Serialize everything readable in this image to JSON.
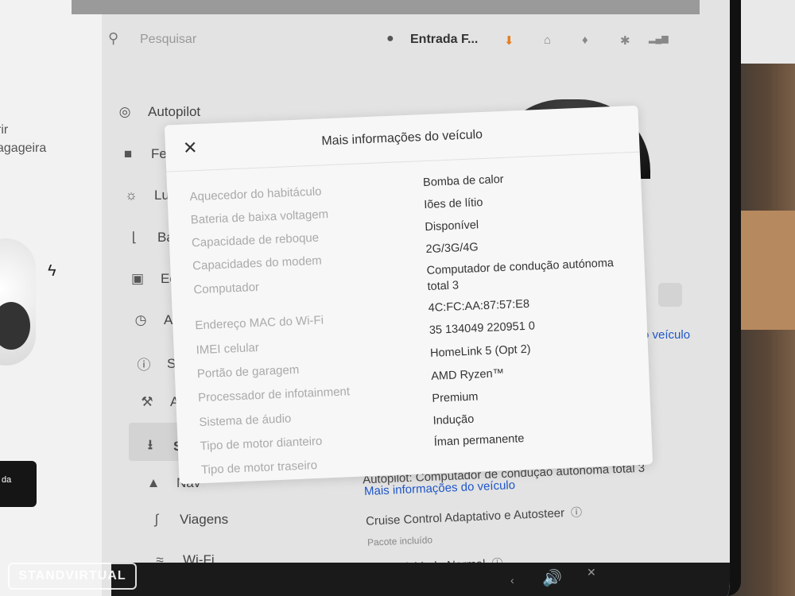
{
  "search": {
    "placeholder": "Pesquisar"
  },
  "header": {
    "profile_name": "Entrada F...",
    "icons": [
      "person-icon",
      "download-icon",
      "garage-icon",
      "bell-icon",
      "bluetooth-icon",
      "lte-signal-icon"
    ]
  },
  "left_panel": {
    "text_1": "rir",
    "text_2": "agageira",
    "button_label": "da"
  },
  "sidebar": {
    "items": [
      {
        "label": "Autopilot",
        "icon": "steering-wheel-icon"
      },
      {
        "label": "Fec",
        "icon": "lock-icon"
      },
      {
        "label": "Luz",
        "icon": "light-icon"
      },
      {
        "label": "Bar",
        "icon": "seat-icon"
      },
      {
        "label": "Ecr",
        "icon": "display-icon"
      },
      {
        "label": "Age",
        "icon": "alarm-icon"
      },
      {
        "label": "Seg",
        "icon": "safety-icon"
      },
      {
        "label": "Ass",
        "icon": "wrench-icon"
      },
      {
        "label": "Sof",
        "icon": "download-icon"
      },
      {
        "label": "Nav",
        "icon": "navigation-icon"
      },
      {
        "label": "Viagens",
        "icon": "trips-icon"
      },
      {
        "label": "Wi-Fi",
        "icon": "wifi-icon"
      }
    ]
  },
  "behind_modal": {
    "link_veiculo": "o veículo",
    "autopilot_line": "Autopilot: Computador de condução autónoma total 3",
    "more_info_link": "Mais informações do veículo",
    "cruise_control": "Cruise Control Adaptativo e Autosteer",
    "package_included": "Pacote incluído",
    "connectivity": "Conectividade Normal"
  },
  "modal": {
    "title": "Mais informações do veículo",
    "rows": [
      {
        "label": "Aquecedor do habitáculo",
        "value": "Bomba de calor"
      },
      {
        "label": "Bateria de baixa voltagem",
        "value": "Iões de lítio"
      },
      {
        "label": "Capacidade de reboque",
        "value": "Disponível"
      },
      {
        "label": "Capacidades do modem",
        "value": "2G/3G/4G"
      },
      {
        "label": "Computador",
        "value": "Computador de condução autónoma total 3"
      },
      {
        "label": "Endereço MAC do Wi-Fi",
        "value": "4C:FC:AA:87:57:E8"
      },
      {
        "label": "IMEI celular",
        "value": "35 134049 220951 0"
      },
      {
        "label": "Portão de garagem",
        "value": "HomeLink 5 (Opt 2)"
      },
      {
        "label": "Processador de infotainment",
        "value": "AMD Ryzen™"
      },
      {
        "label": "Sistema de áudio",
        "value": "Premium"
      },
      {
        "label": "Tipo de motor dianteiro",
        "value": "Indução"
      },
      {
        "label": "Tipo de motor traseiro",
        "value": "Íman permanente"
      }
    ]
  },
  "watermark": "STANDVIRTUAL"
}
